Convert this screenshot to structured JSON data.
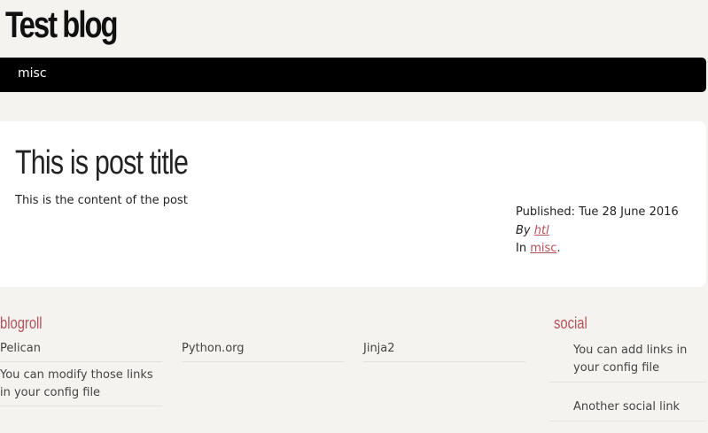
{
  "header": {
    "title": "Test blog"
  },
  "menu": {
    "items": [
      {
        "label": "misc"
      }
    ]
  },
  "post": {
    "title": "This is post title",
    "content": "This is the content of the post",
    "published_label": "Published:",
    "published_date": "Tue 28 June 2016",
    "by_label": "By",
    "author": "htl",
    "in_label": "In",
    "category": "misc",
    "category_suffix": "."
  },
  "blogroll": {
    "title": "blogroll",
    "links": [
      {
        "label": "Pelican"
      },
      {
        "label": "Python.org"
      },
      {
        "label": "Jinja2"
      },
      {
        "label": "You can modify those links in your config file"
      }
    ]
  },
  "social": {
    "title": "social",
    "links": [
      {
        "label": "You can add links in your config file"
      },
      {
        "label": "Another social link"
      }
    ]
  },
  "colors": {
    "accent": "#b4505a",
    "menu_bg": "#000000",
    "page_bg": "#f4f3ef"
  }
}
